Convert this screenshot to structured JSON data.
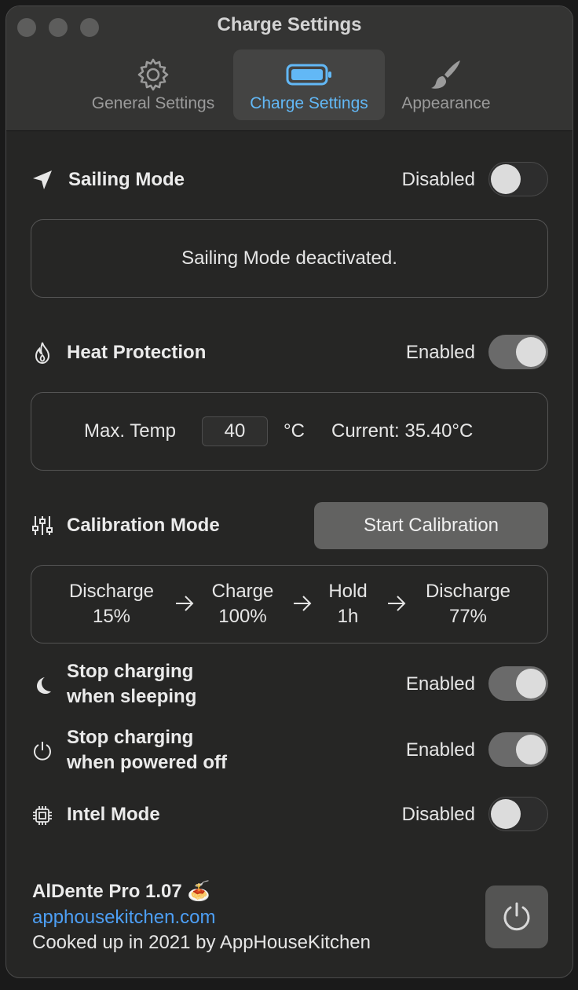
{
  "window": {
    "title": "Charge Settings"
  },
  "tabs": [
    {
      "label": "General Settings",
      "icon": "gear-icon"
    },
    {
      "label": "Charge Settings",
      "icon": "battery-icon",
      "active": true
    },
    {
      "label": "Appearance",
      "icon": "paintbrush-icon"
    }
  ],
  "sailing": {
    "title": "Sailing Mode",
    "state": "Disabled",
    "enabled": false,
    "message": "Sailing Mode deactivated."
  },
  "heat": {
    "title": "Heat Protection",
    "state": "Enabled",
    "enabled": true,
    "max_label": "Max. Temp",
    "max_value": "40",
    "unit": "°C",
    "current": "Current: 35.40°C"
  },
  "calibration": {
    "title": "Calibration Mode",
    "button": "Start Calibration",
    "steps": [
      {
        "name": "Discharge",
        "value": "15%"
      },
      {
        "name": "Charge",
        "value": "100%"
      },
      {
        "name": "Hold",
        "value": "1h"
      },
      {
        "name": "Discharge",
        "value": "77%"
      }
    ]
  },
  "sleeping": {
    "title_line1": "Stop charging",
    "title_line2": "when sleeping",
    "state": "Enabled",
    "enabled": true
  },
  "powered_off": {
    "title_line1": "Stop charging",
    "title_line2": "when powered off",
    "state": "Enabled",
    "enabled": true
  },
  "intel": {
    "title": "Intel Mode",
    "state": "Disabled",
    "enabled": false
  },
  "footer": {
    "app_name": "AlDente Pro 1.07 🍝",
    "link": "apphousekitchen.com",
    "credit": "Cooked up in 2021 by AppHouseKitchen"
  },
  "colors": {
    "accent": "#62b8f6",
    "link": "#4d9ff5"
  }
}
